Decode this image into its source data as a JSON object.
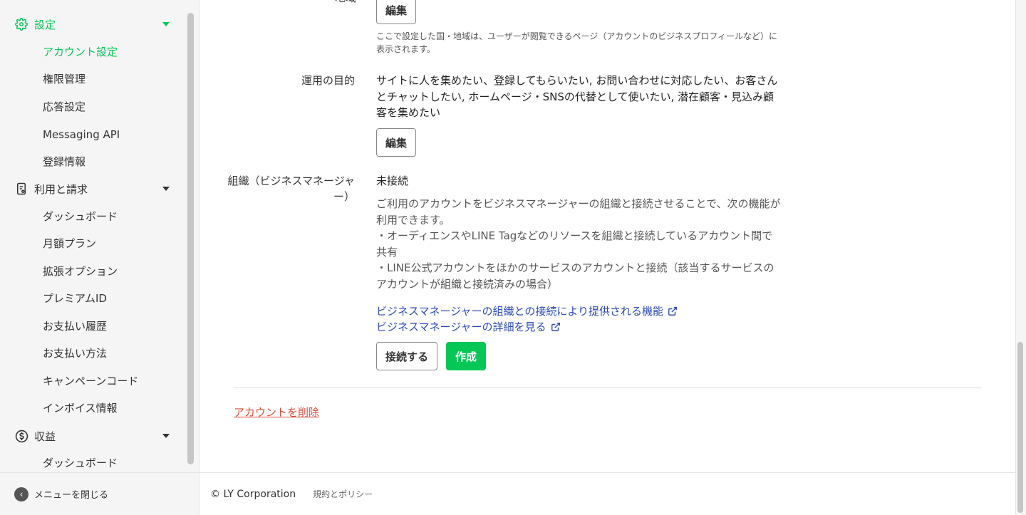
{
  "sidebar": {
    "settings": {
      "label": "設定",
      "icon": "gear-icon",
      "items": [
        "アカウント設定",
        "権限管理",
        "応答設定",
        "Messaging API",
        "登録情報"
      ]
    },
    "billing": {
      "label": "利用と請求",
      "icon": "document-icon",
      "items": [
        "ダッシュボード",
        "月額プラン",
        "拡張オプション",
        "プレミアムID",
        "お支払い履歴",
        "お支払い方法",
        "キャンペーンコード",
        "インボイス情報"
      ]
    },
    "revenue": {
      "label": "収益",
      "icon": "dollar-icon",
      "items": [
        "ダッシュボード"
      ]
    },
    "close_menu": "メニューを閉じる"
  },
  "main": {
    "region": {
      "label": "地域",
      "edit": "編集",
      "note": "ここで設定した国・地域は、ユーザーが閲覧できるページ（アカウントのビジネスプロフィールなど）に表示されます。"
    },
    "purpose": {
      "label": "運用の目的",
      "value": "サイトに人を集めたい、登録してもらいたい, お問い合わせに対応したい、お客さんとチャットしたい, ホームページ・SNSの代替として使いたい, 潜在顧客・見込み顧客を集めたい",
      "edit": "編集"
    },
    "organization": {
      "label": "組織（ビジネスマネージャー）",
      "status": "未接続",
      "desc_line1": "ご利用のアカウントをビジネスマネージャーの組織と接続させることで、次の機能が利用できます。",
      "desc_line2": "・オーディエンスやLINE Tagなどのリソースを組織と接続しているアカウント間で共有",
      "desc_line3": "・LINE公式アカウントをほかのサービスのアカウントと接続（該当するサービスのアカウントが組織と接続済みの場合）",
      "link1": "ビジネスマネージャーの組織との接続により提供される機能",
      "link2": "ビジネスマネージャーの詳細を見る",
      "connect": "接続する",
      "create": "作成"
    },
    "delete_account": "アカウントを削除"
  },
  "footer": {
    "copyright": "© LY Corporation",
    "policy": "規約とポリシー"
  },
  "colors": {
    "accent": "#06c755",
    "link": "#2d4bb8",
    "danger": "#d94a38"
  }
}
